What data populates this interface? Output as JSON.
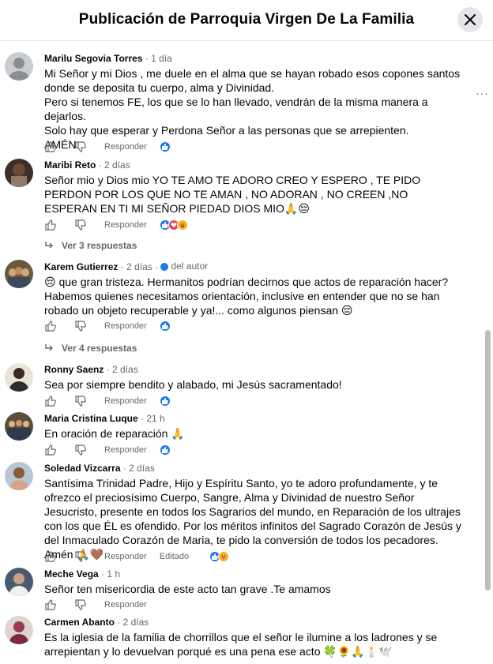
{
  "header": {
    "title": "Publicación de Parroquia Virgen De La Familia"
  },
  "actions_labels": {
    "reply": "Responder",
    "edited": "Editado"
  },
  "comments": [
    {
      "author": "Marilu Segovia Torres",
      "time": "· 1 día",
      "text": "Mi Señor y mi Dios , me duele en el alma que se hayan robado esos copones santos donde se deposita tu cuerpo, alma y Divinidad.\nPero si tenemos FE, los que se lo han llevado, vendrán de la misma manera a dejarlos.\nSolo hay que esperar y Perdona Señor a las personas que se arrepienten.\nAMÉN.",
      "reactions": [
        "like"
      ]
    },
    {
      "author": "Maribi Reto",
      "time": "· 2 días",
      "text": "Señor mio y Dios mio YO TE AMO TE ADORO CREO Y ESPERO , TE PIDO PERDON POR LOS QUE NO TE AMAN , NO ADORAN , NO CREEN ,NO ESPERAN EN TI MI SEÑOR PIEDAD DIOS MIO🙏😔",
      "reactions": [
        "like",
        "love",
        "haha"
      ],
      "replies": "Ver 3 respuestas"
    },
    {
      "author": "Karem Gutierrez",
      "time": "· 2 días ·",
      "badge": "del autor",
      "text": "😔 que gran tristeza. Hermanitos podrían decirnos que actos de reparación hacer? Habemos quienes necesitamos orientación, inclusive en entender que no se han robado un objeto recuperable y ya!... como algunos piensan 😔",
      "reactions": [
        "like"
      ],
      "replies": "Ver 4 respuestas"
    },
    {
      "author": "Ronny Saenz",
      "time": "· 2 días",
      "text": "Sea por siempre bendito y alabado, mi Jesús sacramentado!",
      "reactions": [
        "like"
      ]
    },
    {
      "author": "Maria Cristina Luque",
      "time": "· 21 h",
      "text": "En oración de reparación 🙏",
      "reactions": [
        "like"
      ]
    },
    {
      "author": "Soledad Vizcarra",
      "time": "· 2 días",
      "text": "Santísima Trinidad Padre, Hijo y Espíritu Santo, yo te adoro profundamente, y te ofrezco el preciosísimo Cuerpo, Sangre, Alma y Divinidad de nuestro Señor Jesucristo, presente en todos los Sagrarios del mundo, en Reparación de los ultrajes con los que ÉL es ofendido. Por los méritos infinitos del Sagrado Corazón de Jesús y del Inmaculado Corazón de Maria, te pido la conversión de todos los pecadores. Amén 🙏🤎",
      "edited": true,
      "reactions": [
        "like",
        "haha"
      ]
    },
    {
      "author": "Meche Vega",
      "time": "· 1 h",
      "text": "Señor ten misericordia de este acto tan grave .Te amamos",
      "reactions": []
    },
    {
      "author": "Carmen Abanto",
      "time": "· 2 días",
      "text": "Es la iglesia de la familia de chorrillos que el señor le ilumine a los ladrones y se arrepientan y lo devuelvan porqué es una pena ese acto 🍀🌻🙏🕯️🕊️",
      "reactions": []
    }
  ],
  "icons": {
    "close": "close-icon",
    "like": "thumbs-up-icon",
    "dislike": "thumbs-down-icon",
    "more": "more-options-icon",
    "reply_arrow": "reply-arrow-icon"
  },
  "colors": {
    "accent": "#1877f2",
    "love": "#f33e58",
    "haha": "#f7b125",
    "secondary_text": "#65676b"
  }
}
